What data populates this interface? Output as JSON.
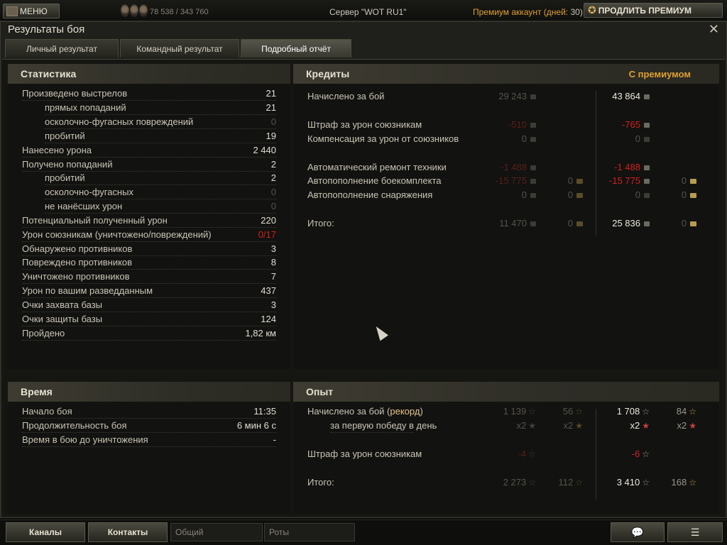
{
  "topbar": {
    "menu_label": "МЕНЮ",
    "experience": "78 538 / 343 760",
    "server": "Сервер \"WOT RU1\"",
    "premium_label": "Премиум аккаунт (дней:",
    "premium_days": " 30)",
    "prolong_label": "ПРОДЛИТЬ ПРЕМИУМ"
  },
  "window": {
    "title": "Результаты боя",
    "close": "✕",
    "tabs": [
      "Личный результат",
      "Командный результат",
      "Подробный отчёт"
    ]
  },
  "stats": {
    "title": "Статистика",
    "rows": [
      {
        "label": "Произведено выстрелов",
        "value": "21"
      },
      {
        "label": "прямых попаданий",
        "value": "21"
      },
      {
        "label": "осколочно-фугасных повреждений",
        "value": "0"
      },
      {
        "label": "пробитий",
        "value": "19"
      },
      {
        "label": "Нанесено урона",
        "value": "2 440"
      },
      {
        "label": "Получено попаданий",
        "value": "2"
      },
      {
        "label": "пробитий",
        "value": "2"
      },
      {
        "label": "осколочно-фугасных",
        "value": "0"
      },
      {
        "label": "не нанёсших урон",
        "value": "0"
      },
      {
        "label": "Потенциальный полученный урон",
        "value": "220"
      },
      {
        "label": "Урон союзникам (уничтожено/повреждений)",
        "value": "0/17"
      },
      {
        "label": "Обнаружено противников",
        "value": "3"
      },
      {
        "label": "Повреждено противников",
        "value": "8"
      },
      {
        "label": "Уничтожено противников",
        "value": "7"
      },
      {
        "label": "Урон по вашим разведданным",
        "value": "437"
      },
      {
        "label": "Очки захвата базы",
        "value": "3"
      },
      {
        "label": "Очки защиты базы",
        "value": "124"
      },
      {
        "label": "Пройдено",
        "value": "1,82 км"
      }
    ]
  },
  "credits": {
    "title": "Кредиты",
    "premium_header": "С премиумом",
    "rows": [
      {
        "label": "Начислено за бой",
        "base": "29 243",
        "prem": "43 864"
      },
      {
        "label": "Штраф за урон союзникам",
        "base": "-510",
        "prem": "-765"
      },
      {
        "label": "Компенсация за урон от союзников",
        "base": "0",
        "prem": "0"
      },
      {
        "label": "Автоматический ремонт техники",
        "base": "-1 488",
        "prem": "-1 488"
      },
      {
        "label": "Автопополнение боекомплекта",
        "base": "-15 775",
        "base_gold": "0",
        "prem": "-15 775",
        "prem_gold": "0"
      },
      {
        "label": "Автопополнение снаряжения",
        "base": "0",
        "base_gold": "0",
        "prem": "0",
        "prem_gold": "0"
      },
      {
        "label": "Итого:",
        "base": "11 470",
        "base_gold": "0",
        "prem": "25 836",
        "prem_gold": "0"
      }
    ]
  },
  "time": {
    "title": "Время",
    "rows": [
      {
        "label": "Начало боя",
        "value": "11:35"
      },
      {
        "label": "Продолжительность боя",
        "value": "6 мин 6 с"
      },
      {
        "label": "Время в бою до уничтожения",
        "value": "-"
      }
    ]
  },
  "experience": {
    "title": "Опыт",
    "rows": [
      {
        "label": "Начислено за бой (",
        "label_hl": "рекорд",
        "label_end": ")",
        "base": "1 139",
        "base_free": "56",
        "prem": "1 708",
        "prem_free": "84"
      },
      {
        "label": "за первую победу в день",
        "base": "x2",
        "base_free": "x2",
        "prem": "x2",
        "prem_free": "x2"
      },
      {
        "label": "Штраф за урон союзникам",
        "base": "-4",
        "prem": "-6"
      },
      {
        "label": "Итого:",
        "base": "2 273",
        "base_free": "112",
        "prem": "3 410",
        "prem_free": "168"
      }
    ]
  },
  "bottombar": {
    "channels": "Каналы",
    "contacts": "Контакты",
    "general_placeholder": "Общий",
    "companies_placeholder": "Роты"
  }
}
